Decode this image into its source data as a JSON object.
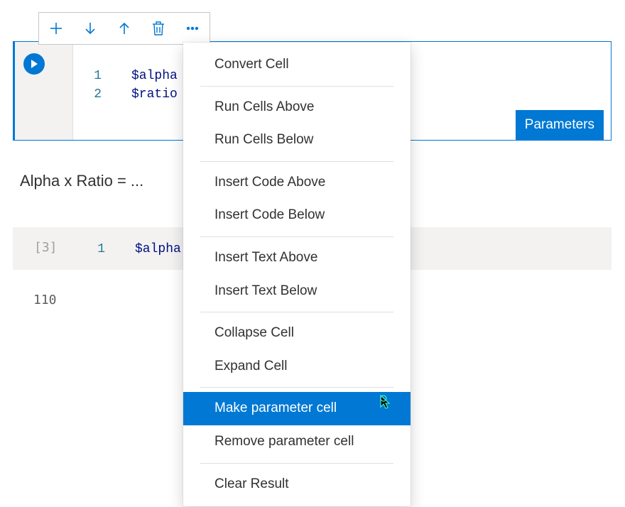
{
  "toolbar": {
    "add_label": "Add cell",
    "down_label": "Move down",
    "up_label": "Move up",
    "delete_label": "Delete",
    "more_label": "More"
  },
  "cell1": {
    "line1_num": "1",
    "line1_code": "$alpha",
    "line2_num": "2",
    "line2_code": "$ratio"
  },
  "param_tag": "Parameters",
  "text_cell": "Alpha x Ratio = ...",
  "cell2": {
    "prompt": "[3]",
    "line1_num": "1",
    "line1_code": "$alpha",
    "output": "110"
  },
  "menu": {
    "convert": "Convert Cell",
    "run_above": "Run Cells Above",
    "run_below": "Run Cells Below",
    "insert_code_above": "Insert Code Above",
    "insert_code_below": "Insert Code Below",
    "insert_text_above": "Insert Text Above",
    "insert_text_below": "Insert Text Below",
    "collapse": "Collapse Cell",
    "expand": "Expand Cell",
    "make_param": "Make parameter cell",
    "remove_param": "Remove parameter cell",
    "clear_result": "Clear Result"
  }
}
